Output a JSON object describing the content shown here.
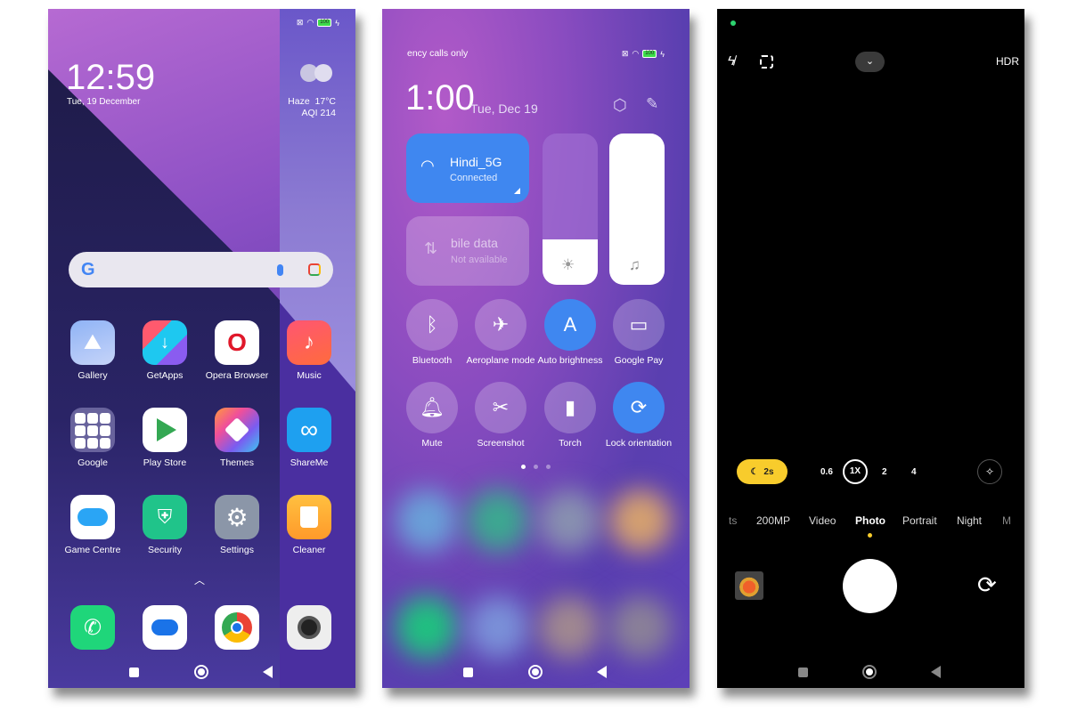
{
  "home": {
    "status": {
      "battery": "100"
    },
    "clock": {
      "time": "12:59",
      "date": "Tue, 19 December"
    },
    "weather": {
      "condition": "Haze",
      "temp": "17°C",
      "aqi": "AQI 214",
      "icon": "haze-icon"
    },
    "search": {
      "logo": "G",
      "icons": [
        "mic-icon",
        "lens-icon"
      ]
    },
    "apps": [
      {
        "label": "Gallery",
        "icon": "gallery-icon",
        "color": "#7fa7f0"
      },
      {
        "label": "GetApps",
        "icon": "getapps-icon",
        "color": "#36c6a0"
      },
      {
        "label": "Opera Browser",
        "icon": "opera-icon",
        "color": "#ffffff"
      },
      {
        "label": "Music",
        "icon": "music-icon",
        "color": "#f0435e"
      },
      {
        "label": "Google",
        "icon": "google-folder-icon",
        "color": "#6d6a9a"
      },
      {
        "label": "Play Store",
        "icon": "play-store-icon",
        "color": "#ffffff"
      },
      {
        "label": "Themes",
        "icon": "themes-icon",
        "color": "#f35fa0"
      },
      {
        "label": "ShareMe",
        "icon": "shareme-icon",
        "color": "#1ea0f0"
      },
      {
        "label": "Game Centre",
        "icon": "game-centre-icon",
        "color": "#ffffff"
      },
      {
        "label": "Security",
        "icon": "security-icon",
        "color": "#20c48a"
      },
      {
        "label": "Settings",
        "icon": "settings-icon",
        "color": "#8b96a8"
      },
      {
        "label": "Cleaner",
        "icon": "cleaner-icon",
        "color": "#ffa030"
      }
    ],
    "dock": [
      {
        "icon": "phone-icon",
        "color": "#1fd67a"
      },
      {
        "icon": "messages-icon",
        "color": "#ffffff"
      },
      {
        "icon": "chrome-icon",
        "color": "#ffffff"
      },
      {
        "icon": "camera-icon",
        "color": "#eeeeee"
      }
    ]
  },
  "control_center": {
    "status": {
      "carrier": "ency calls only",
      "battery": "100"
    },
    "time": "1:00",
    "date": "Tue, Dec 19",
    "wifi": {
      "name": "Hindi_5G",
      "status": "Connected"
    },
    "mobile_data": {
      "name": "bile data",
      "status": "Not available"
    },
    "brightness_level": 0.3,
    "volume_level": 1.0,
    "toggles": [
      {
        "label": "Bluetooth",
        "icon": "bluetooth-icon",
        "on": false
      },
      {
        "label": "Aeroplane mode",
        "icon": "airplane-icon",
        "on": false
      },
      {
        "label": "Auto brightness",
        "icon": "auto-brightness-icon",
        "on": true
      },
      {
        "label": "Google Pay",
        "icon": "card-icon",
        "on": false
      },
      {
        "label": "Mute",
        "icon": "bell-icon",
        "on": false
      },
      {
        "label": "Screenshot",
        "icon": "screenshot-icon",
        "on": false
      },
      {
        "label": "Torch",
        "icon": "torch-icon",
        "on": false
      },
      {
        "label": "Lock orientation",
        "icon": "rotation-lock-icon",
        "on": true
      }
    ],
    "page_indicator": {
      "pages": 3,
      "current": 1
    }
  },
  "camera": {
    "top": {
      "hdr": "HDR"
    },
    "night_timer": "2s",
    "zoom_levels": [
      "0.6",
      "1X",
      "2",
      "4"
    ],
    "selected_zoom": "1X",
    "modes": [
      "ts",
      "200MP",
      "Video",
      "Photo",
      "Portrait",
      "Night",
      "M"
    ],
    "selected_mode": "Photo"
  }
}
